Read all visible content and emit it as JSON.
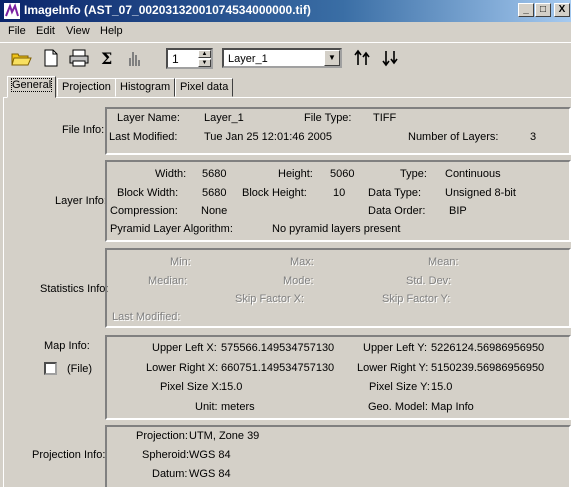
{
  "window": {
    "title": "ImageInfo (AST_07_00203132001074534000000.tif)",
    "minimize_glyph": "_",
    "maximize_glyph": "□",
    "close_glyph": "X"
  },
  "menu": [
    "File",
    "Edit",
    "View",
    "Help"
  ],
  "toolbar": {
    "icons": [
      "open-folder-icon",
      "new-document-icon",
      "print-icon",
      "sigma-icon",
      "histogram-icon",
      "sort-ascending-icon",
      "sort-descending-icon"
    ],
    "layer_number": "1",
    "layer_name": "Layer_1"
  },
  "tabs": [
    {
      "label": "General",
      "active": true
    },
    {
      "label": "Projection",
      "active": false
    },
    {
      "label": "Histogram",
      "active": false
    },
    {
      "label": "Pixel data",
      "active": false
    }
  ],
  "file_info": {
    "section_label": "File Info:",
    "layer_name_label": "Layer Name:",
    "layer_name": "Layer_1",
    "file_type_label": "File Type:",
    "file_type": "TIFF",
    "last_modified_label": "Last Modified:",
    "last_modified": "Tue Jan 25 12:01:46 2005",
    "num_layers_label": "Number of Layers:",
    "num_layers": "3"
  },
  "layer_info": {
    "section_label": "Layer Info:",
    "width_label": "Width:",
    "width": "5680",
    "height_label": "Height:",
    "height": "5060",
    "type_label": "Type:",
    "type": "Continuous",
    "block_width_label": "Block Width:",
    "block_width": "5680",
    "block_height_label": "Block Height:",
    "block_height": "10",
    "data_type_label": "Data Type:",
    "data_type": "Unsigned 8-bit",
    "compression_label": "Compression:",
    "compression": "None",
    "data_order_label": "Data Order:",
    "data_order": "BIP",
    "pyramid_label": "Pyramid Layer Algorithm:",
    "pyramid": "No pyramid layers present"
  },
  "statistics_info": {
    "section_label": "Statistics Info:",
    "min_label": "Min:",
    "max_label": "Max:",
    "mean_label": "Mean:",
    "median_label": "Median:",
    "mode_label": "Mode:",
    "std_label": "Std. Dev:",
    "skipx_label": "Skip Factor X:",
    "skipy_label": "Skip Factor Y:",
    "last_modified_label": "Last Modified:"
  },
  "map_info": {
    "section_label": "Map Info:",
    "file_checkbox_label": "(File)",
    "upper_left_x_label": "Upper Left X:",
    "upper_left_x": "575566.149534757130",
    "upper_left_y_label": "Upper Left Y:",
    "upper_left_y": "5226124.56986956950",
    "lower_right_x_label": "Lower Right X:",
    "lower_right_x": "660751.149534757130",
    "lower_right_y_label": "Lower Right Y:",
    "lower_right_y": "5150239.56986956950",
    "pixel_size_x_label": "Pixel Size X:",
    "pixel_size_x": "15.0",
    "pixel_size_y_label": "Pixel Size Y:",
    "pixel_size_y": "15.0",
    "unit_label": "Unit:",
    "unit": "meters",
    "geo_model_label": "Geo. Model:",
    "geo_model": "Map Info"
  },
  "projection_info": {
    "section_label": "Projection Info:",
    "projection_label": "Projection:",
    "projection": "UTM, Zone 39",
    "spheroid_label": "Spheroid:",
    "spheroid": "WGS 84",
    "datum_label": "Datum:",
    "datum": "WGS 84"
  }
}
